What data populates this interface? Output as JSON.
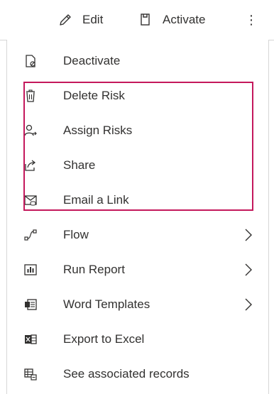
{
  "commandbar": {
    "edit_label": "Edit",
    "activate_label": "Activate",
    "more_label": "⋮"
  },
  "menu": {
    "items": [
      {
        "label": "Deactivate",
        "icon": "deactivate-icon",
        "has_submenu": false
      },
      {
        "label": "Delete Risk",
        "icon": "trash-icon",
        "has_submenu": false
      },
      {
        "label": "Assign Risks",
        "icon": "assign-person-icon",
        "has_submenu": false
      },
      {
        "label": "Share",
        "icon": "share-icon",
        "has_submenu": false
      },
      {
        "label": "Email a Link",
        "icon": "email-link-icon",
        "has_submenu": false
      },
      {
        "label": "Flow",
        "icon": "flow-icon",
        "has_submenu": true
      },
      {
        "label": "Run Report",
        "icon": "report-icon",
        "has_submenu": true
      },
      {
        "label": "Word Templates",
        "icon": "word-icon",
        "has_submenu": true
      },
      {
        "label": "Export to Excel",
        "icon": "excel-icon",
        "has_submenu": false
      },
      {
        "label": "See associated records",
        "icon": "associated-records-icon",
        "has_submenu": false
      }
    ]
  },
  "colors": {
    "highlight_border": "#c4185c",
    "text": "#323130",
    "icon": "#323130",
    "divider": "#d6d6d6"
  }
}
